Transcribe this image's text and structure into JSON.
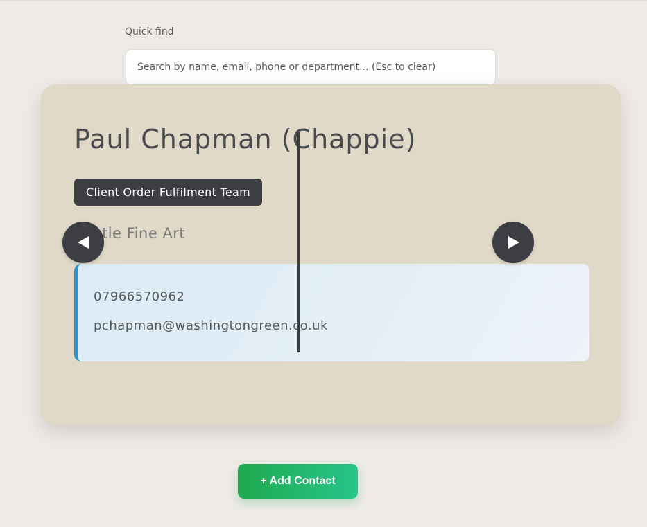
{
  "search": {
    "label": "Quick find",
    "placeholder": "Search by name, email, phone or department... (Esc to clear)",
    "value": ""
  },
  "contact": {
    "name": "Paul Chapman (Chappie)",
    "team": "Client Order Fulfilment Team",
    "company": "Castle Fine Art",
    "phone": "07966570962",
    "email": "pchapman@washingtongreen.co.uk"
  },
  "navigation": {
    "prev_icon": "triangle-left-icon",
    "next_icon": "triangle-right-icon"
  },
  "actions": {
    "add_contact_label": "+ Add Contact"
  },
  "colors": {
    "background": "#eeebe6",
    "card": "#e0d9c7",
    "badge": "#3c3e44",
    "accent_blue": "#2a95d1",
    "button_green_start": "#1fa84f",
    "button_green_end": "#27c589"
  }
}
